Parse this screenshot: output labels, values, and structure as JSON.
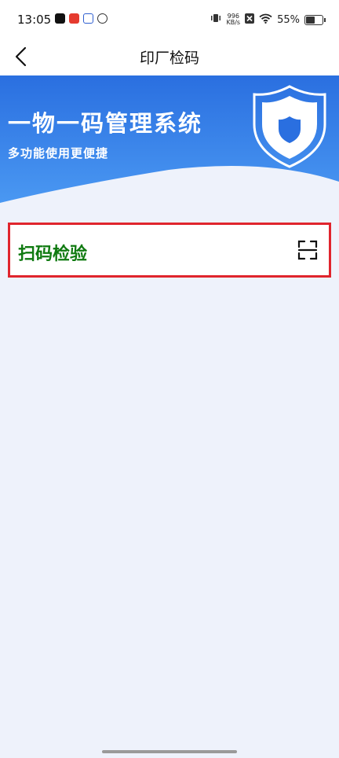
{
  "status_bar": {
    "time": "13:05",
    "net_speed_value": "996",
    "net_speed_unit": "KB/s",
    "battery_percent": "55%",
    "battery_level": 0.55,
    "app_icons": [
      "tiktok-icon",
      "red-app-icon",
      "baidu-paw-icon",
      "leaf-app-icon"
    ],
    "right_icons": [
      "vibrate-icon",
      "no-sim-icon",
      "wifi-icon",
      "battery-icon"
    ]
  },
  "nav": {
    "title": "印厂检码",
    "back_icon": "chevron-left-icon"
  },
  "banner": {
    "title": "一物一码管理系统",
    "subtitle": "多功能使用更便捷",
    "icon": "shield-icon",
    "colors": {
      "top": "#2a6fe0",
      "bottom": "#4a98f2"
    }
  },
  "scan": {
    "label": "扫码检验",
    "icon": "scan-icon",
    "label_color": "#0f7a10",
    "highlight_color": "#e0252d"
  }
}
